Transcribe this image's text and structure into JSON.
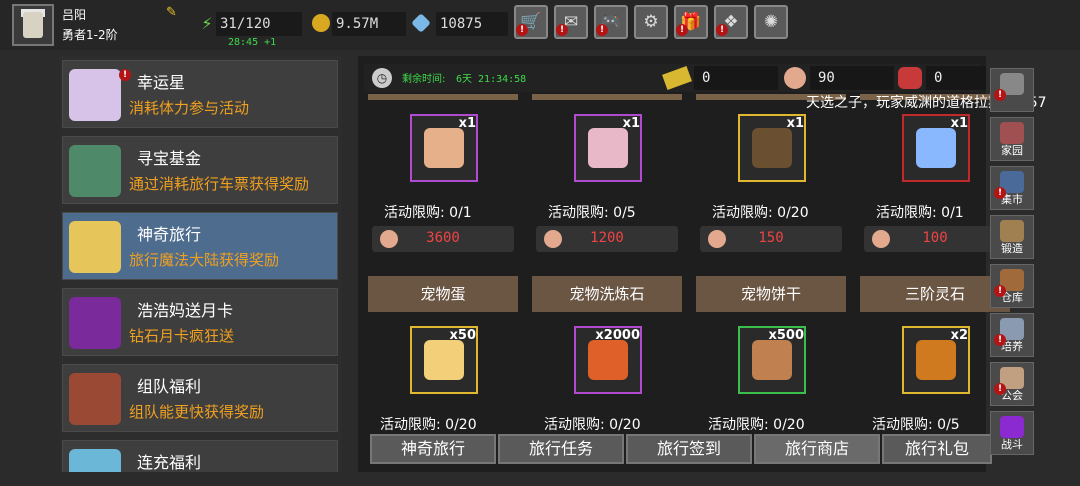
{
  "player": {
    "name": "吕阳",
    "rank": "勇者1-2阶"
  },
  "resources": {
    "stamina": "31/120",
    "stamina_timer": "28:45 +1",
    "gold": "9.57M",
    "gems": "10875"
  },
  "top_buttons": [
    {
      "name": "shop-cart-button",
      "glyph": "🛒"
    },
    {
      "name": "mail-button",
      "glyph": "✉"
    },
    {
      "name": "gamepad-button",
      "glyph": "🎮"
    },
    {
      "name": "settings-button",
      "glyph": "⚙"
    },
    {
      "name": "gift-button",
      "glyph": "🎁"
    },
    {
      "name": "event-button",
      "glyph": "❖"
    },
    {
      "name": "firework-button",
      "glyph": "✺"
    }
  ],
  "left_menu": [
    {
      "title": "幸运星",
      "desc": "消耗体力参与活动",
      "selected": false,
      "icon_color": "#d7c2e8",
      "alert": true
    },
    {
      "title": "寻宝基金",
      "desc": "通过消耗旅行车票获得奖励",
      "selected": false,
      "icon_color": "#4e8a6a",
      "alert": false
    },
    {
      "title": "神奇旅行",
      "desc": "旅行魔法大陆获得奖励",
      "selected": true,
      "icon_color": "#e6c65a",
      "alert": false
    },
    {
      "title": "浩浩妈送月卡",
      "desc": "钻石月卡疯狂送",
      "selected": false,
      "icon_color": "#7a2a9a",
      "alert": false
    },
    {
      "title": "组队福利",
      "desc": "组队能更快获得奖励",
      "selected": false,
      "icon_color": "#9a4a34",
      "alert": false
    },
    {
      "title": "连充福利",
      "desc": "",
      "selected": false,
      "icon_color": "#6ab7d8",
      "alert": false
    }
  ],
  "header": {
    "remaining_label": "剩余时间:",
    "remaining_value": "6天 21:34:58",
    "ticket": "0",
    "pouch": "90",
    "bag": "0"
  },
  "marquee": "天选之子，玩家威渊的道格拉斯47457",
  "row1": [
    {
      "qty": "x1",
      "limit": "活动限购: 0/1",
      "price": "3600",
      "border": "#b04ad0",
      "item_color": "#e6b08a"
    },
    {
      "qty": "x1",
      "limit": "活动限购: 0/5",
      "price": "1200",
      "border": "#b04ad0",
      "item_color": "#e8b8c8"
    },
    {
      "qty": "x1",
      "limit": "活动限购: 0/20",
      "price": "150",
      "border": "#e0b830",
      "item_color": "#6a5030"
    },
    {
      "qty": "x1",
      "limit": "活动限购: 0/1",
      "price": "100",
      "border": "#c02a2a",
      "item_color": "#8ab8ff"
    }
  ],
  "row2": [
    {
      "title": "宠物蛋",
      "qty": "x50",
      "limit": "活动限购: 0/20",
      "border": "#e0b830",
      "item_color": "#f4cf7a"
    },
    {
      "title": "宠物洗炼石",
      "qty": "x2000",
      "limit": "活动限购: 0/20",
      "border": "#b04ad0",
      "item_color": "#e0602a"
    },
    {
      "title": "宠物饼干",
      "qty": "x500",
      "limit": "活动限购: 0/20",
      "border": "#3ac04a",
      "item_color": "#c08050"
    },
    {
      "title": "三阶灵石",
      "qty": "x2",
      "limit": "活动限购: 0/5",
      "border": "#e0b830",
      "item_color": "#d07a20"
    }
  ],
  "bottom_tabs": [
    "神奇旅行",
    "旅行任务",
    "旅行签到",
    "旅行商店",
    "旅行礼包"
  ],
  "active_tab": 3,
  "side_menu": [
    {
      "label": "",
      "color": "#888888",
      "alert": true
    },
    {
      "label": "家园",
      "color": "#a05050",
      "alert": false
    },
    {
      "label": "集市",
      "color": "#4a6a9a",
      "alert": true
    },
    {
      "label": "锻造",
      "color": "#a08050",
      "alert": false
    },
    {
      "label": "仓库",
      "color": "#a06a3a",
      "alert": true
    },
    {
      "label": "培养",
      "color": "#8a9ab0",
      "alert": true
    },
    {
      "label": "公会",
      "color": "#c0a080",
      "alert": true
    },
    {
      "label": "战斗",
      "color": "#8a2ad0",
      "alert": false
    }
  ]
}
